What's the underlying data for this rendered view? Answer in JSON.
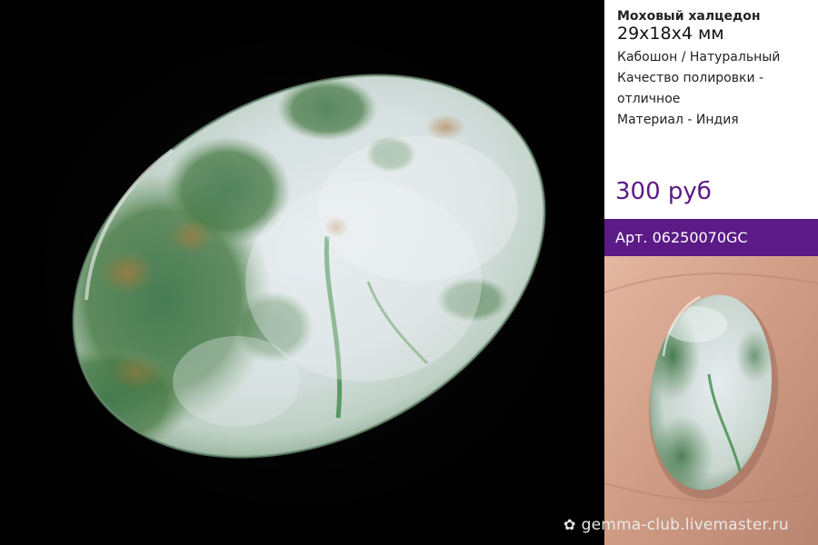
{
  "product": {
    "name": "Моховый халцедон",
    "size": "29x18x4 мм",
    "details": [
      "Кабошон / Натуральный",
      "Качество полировки -",
      "отличное",
      "Материал - Индия"
    ],
    "price": "300 руб",
    "article": "Арт. 06250070GC"
  },
  "watermark": {
    "text": "gemma-club.livemaster.ru",
    "icon": "flower-icon"
  },
  "colors": {
    "accent": "#5b1a86",
    "background": "#000000"
  }
}
